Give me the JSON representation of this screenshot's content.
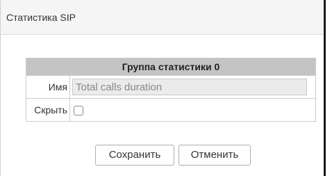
{
  "panel": {
    "title": "Статистика SIP"
  },
  "group": {
    "header": "Группа статистики 0",
    "fields": {
      "name_label": "Имя",
      "name_value": "Total calls duration",
      "hide_label": "Скрыть",
      "hide_checked": false
    }
  },
  "actions": {
    "save_label": "Сохранить",
    "cancel_label": "Отменить"
  }
}
